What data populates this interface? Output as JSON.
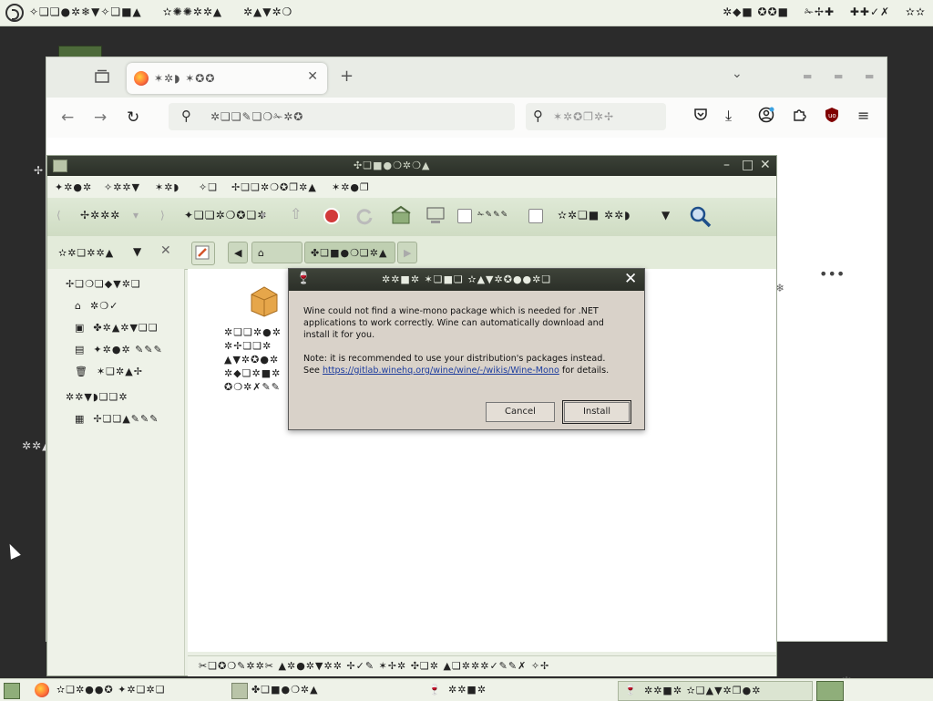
{
  "top_panel": {
    "menu": [
      "✧❏❏●✲❄▼✧❏■▲",
      "✫✺✺✲✲▲",
      "✲▲▼✲❍"
    ],
    "right": [
      "✲◆■ ✪✪■",
      "✁✢✚",
      "✚✚✓✗",
      "✫✫"
    ]
  },
  "firefox": {
    "tab_title": "✶✲◗ ✶✪✪",
    "url_placeholder": "✲❏❏✎❏❍✁✲✪",
    "search_placeholder": "✶✲✪❐✲✢",
    "fragment": "❄"
  },
  "file_manager": {
    "title": "✣❏■●❍✲❍▲",
    "menu": [
      "✦✲●✲",
      "✧✲✲▼",
      "✶✲◗",
      "✧❏",
      "✢❏❏✲❍✪❐✲▲",
      "✶✲●❐"
    ],
    "toolbar": {
      "back": "✢✲✲✲",
      "forward": "✦❏❏✲❍✪❏✲",
      "view_as": "✫✲❏■ ✲✲◗",
      "location_label": "✫✲❏✲✲▲"
    },
    "path": {
      "home": "✲❍✓",
      "current": "✤❏■●❍❏✲▲"
    },
    "sidebar": {
      "places_header": "✢❏❍❏◆▼✲❏",
      "places": [
        "✲❍✓",
        "✤✲▲✲▼❏❏",
        "✦✲●✲ ✎✎✎",
        "✶❏✲▲✢"
      ],
      "devices_header": "✲✲▼◗❏❏✲",
      "devices": [
        "✢❏❏▲✎✎✎"
      ]
    },
    "file_label_lines": [
      "✲❏❏✲●✲",
      "✲✢❏❏✲",
      "▲▼✲✪●✲",
      "✲◆❏✲■✲",
      "✪❍✲✗✎✎"
    ],
    "status": "✂❏✪❍✎✲✲✂ ▲✲●✲▼✲✲ ✢✓✎ ✶✢✲ ✣❏✲ ▲❏✲✲✲✓✎✎✗ ✧✢"
  },
  "dialog": {
    "title": "✲✲■✲ ✶❏■❏ ✫▲▼✲✪●●✲❏",
    "message_1": "Wine could not find a wine-mono package which is needed for .NET applications to work correctly. Wine can automatically download and install it for you.",
    "message_2_prefix": "Note: it is recommended to use your distribution's packages instead. See ",
    "message_2_link": "https://gitlab.winehq.org/wine/wine/-/wikis/Wine-Mono",
    "message_2_suffix": " for details.",
    "cancel_label": "Cancel",
    "install_label": "Install"
  },
  "taskbar": {
    "items": [
      "✫❏✲●●✪ ✦✲❏✲❏",
      "✤❏■●❍✲▲",
      "✲✲■✲",
      "✲✲■✲ ✫❏▲▼✲❐●✲"
    ]
  },
  "desktop": {
    "left_fragment_1": "✢",
    "left_fragment_2": "✲✲▲"
  },
  "colors": {
    "accent_green": "#cfdcc3",
    "dialog_bg": "#d9d2c9",
    "link": "#1c3c9e"
  }
}
